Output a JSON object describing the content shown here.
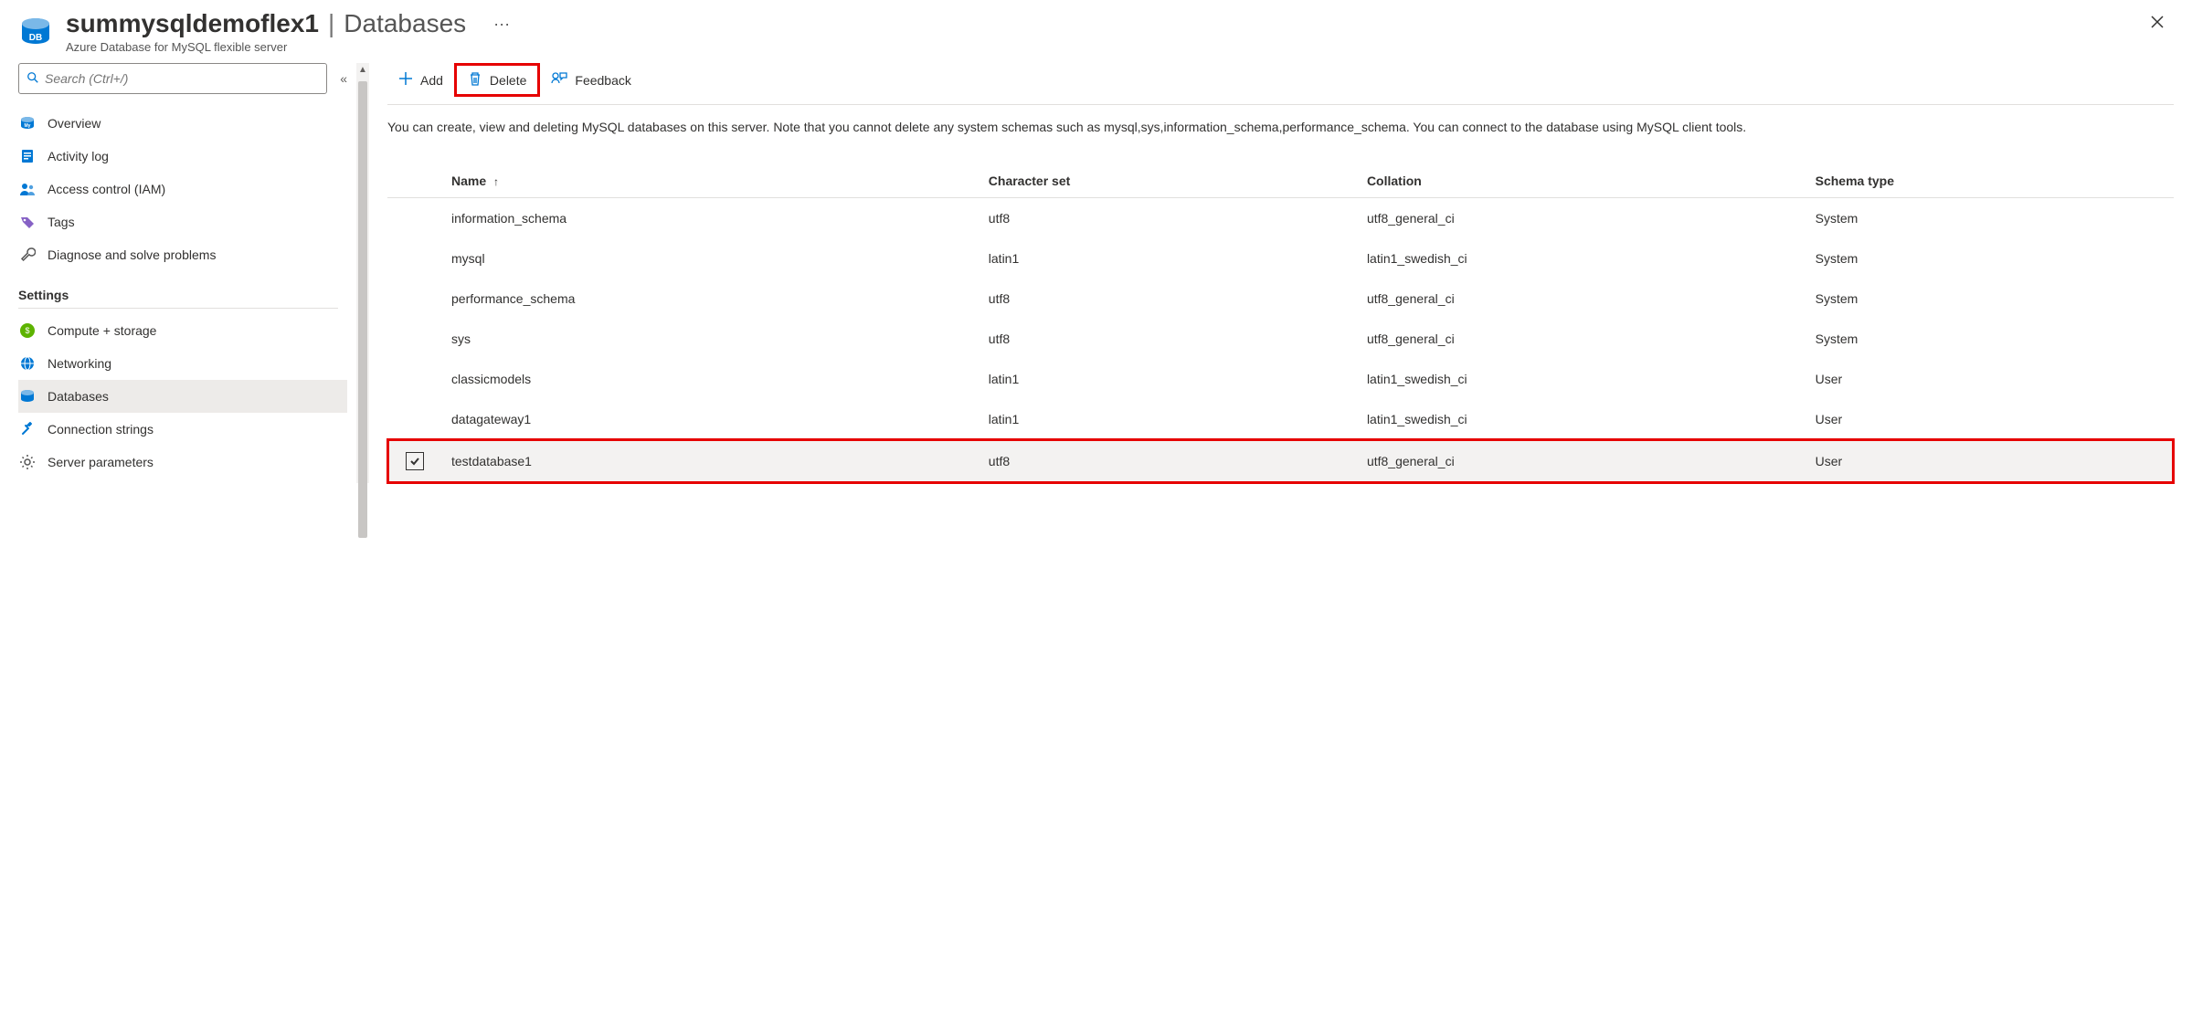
{
  "header": {
    "resource_name": "summysqldemoflex1",
    "separator": "|",
    "section": "Databases",
    "more_label": "···",
    "subtitle": "Azure Database for MySQL flexible server"
  },
  "sidebar": {
    "search_placeholder": "Search (Ctrl+/)",
    "collapse_label": "«",
    "items_top": [
      {
        "label": "Overview",
        "icon": "mysql-icon"
      },
      {
        "label": "Activity log",
        "icon": "log-icon"
      },
      {
        "label": "Access control (IAM)",
        "icon": "people-icon"
      },
      {
        "label": "Tags",
        "icon": "tag-icon"
      },
      {
        "label": "Diagnose and solve problems",
        "icon": "wrench-icon"
      }
    ],
    "section_settings": "Settings",
    "items_settings": [
      {
        "label": "Compute + storage",
        "icon": "compute-icon"
      },
      {
        "label": "Networking",
        "icon": "network-icon"
      },
      {
        "label": "Databases",
        "icon": "db-icon",
        "selected": true
      },
      {
        "label": "Connection strings",
        "icon": "conn-icon"
      },
      {
        "label": "Server parameters",
        "icon": "gear-icon"
      }
    ]
  },
  "toolbar": {
    "add_label": "Add",
    "delete_label": "Delete",
    "feedback_label": "Feedback"
  },
  "description": "You can create, view and deleting MySQL databases on this server. Note that you cannot delete any system schemas such as mysql,sys,information_schema,performance_schema. You can connect to the database using MySQL client tools.",
  "table": {
    "headers": {
      "name": "Name",
      "charset": "Character set",
      "collation": "Collation",
      "schema_type": "Schema type"
    },
    "sort_indicator": "↑",
    "rows": [
      {
        "name": "information_schema",
        "charset": "utf8",
        "collation": "utf8_general_ci",
        "schema_type": "System"
      },
      {
        "name": "mysql",
        "charset": "latin1",
        "collation": "latin1_swedish_ci",
        "schema_type": "System"
      },
      {
        "name": "performance_schema",
        "charset": "utf8",
        "collation": "utf8_general_ci",
        "schema_type": "System"
      },
      {
        "name": "sys",
        "charset": "utf8",
        "collation": "utf8_general_ci",
        "schema_type": "System"
      },
      {
        "name": "classicmodels",
        "charset": "latin1",
        "collation": "latin1_swedish_ci",
        "schema_type": "User"
      },
      {
        "name": "datagateway1",
        "charset": "latin1",
        "collation": "latin1_swedish_ci",
        "schema_type": "User"
      },
      {
        "name": "testdatabase1",
        "charset": "utf8",
        "collation": "utf8_general_ci",
        "schema_type": "User",
        "checked": true,
        "highlighted": true
      }
    ]
  }
}
